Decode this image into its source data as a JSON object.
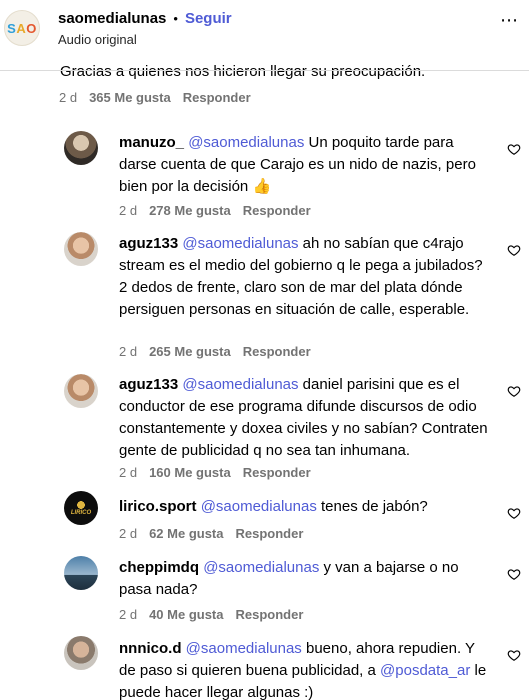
{
  "header": {
    "logo": {
      "s": "S",
      "a": "A",
      "o": "O"
    },
    "username": "saomedialunas",
    "dot": "•",
    "follow_label": "Seguir",
    "subtitle": "Audio original",
    "more": "⋯"
  },
  "partial": {
    "text": "Gracias a quienes nos hicieron llegar su preocupación.",
    "time": "2 d",
    "likes": "365 Me gusta",
    "reply": "Responder"
  },
  "comments": [
    {
      "user": "manuzo_",
      "mention": "@saomedialunas",
      "text": " Un poquito tarde para darse cuenta de que Carajo es un nido de nazis, pero bien por la decisión",
      "emoji": "👍",
      "time": "2 d",
      "likes": "278 Me gusta",
      "reply": "Responder"
    },
    {
      "user": "aguz133",
      "mention": "@saomedialunas",
      "text": " ah no sabían que c4rajo stream es el medio del gobierno q le pega a jubilados? 2 dedos de frente, claro son de mar del plata dónde persiguen personas en situación de calle, esperable.",
      "time": "2 d",
      "likes": "265 Me gusta",
      "reply": "Responder"
    },
    {
      "user": "aguz133",
      "mention": "@saomedialunas",
      "text": " daniel parisini que es el conductor de ese programa difunde discursos de odio constantemente y doxea civiles y no sabían? Contraten gente de publicidad q no sea tan inhumana.",
      "time": "2 d",
      "likes": "160 Me gusta",
      "reply": "Responder"
    },
    {
      "user": "lirico.sport",
      "mention": "@saomedialunas",
      "text": " tenes de jabón?",
      "time": "2 d",
      "likes": "62 Me gusta",
      "reply": "Responder"
    },
    {
      "user": "cheppimdq",
      "mention": "@saomedialunas",
      "text": " y van a bajarse o no pasa nada?",
      "time": "2 d",
      "likes": "40 Me gusta",
      "reply": "Responder"
    },
    {
      "user": "nnnico.d",
      "mention": "@saomedialunas",
      "text": " bueno, ahora repudien. Y de paso si quieren buena publicidad, a ",
      "mention2": "@posdata_ar",
      "text2": " le puede hacer llegar algunas :)"
    }
  ],
  "lirico_badge": "LIRICO",
  "colors": {
    "link": "#4f5bd5",
    "meta": "#737373",
    "divider": "#dbdbdb"
  }
}
